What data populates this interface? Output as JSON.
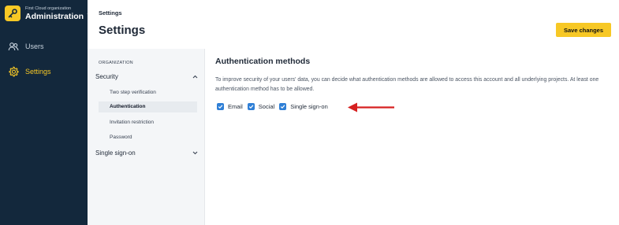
{
  "sidebar": {
    "org_subtitle": "First Cloud organization",
    "org_title": "Administration",
    "items": [
      {
        "label": "Users",
        "icon": "users-icon"
      },
      {
        "label": "Settings",
        "icon": "gear-icon"
      }
    ]
  },
  "header": {
    "breadcrumb": "Settings",
    "title": "Settings",
    "save_label": "Save changes"
  },
  "subnav": {
    "section_heading": "ORGANIZATION",
    "groups": [
      {
        "label": "Security",
        "items": [
          "Two step verification",
          "Authentication",
          "Invitation restriction",
          "Password"
        ]
      },
      {
        "label": "Single sign-on"
      }
    ]
  },
  "main": {
    "title": "Authentication methods",
    "description": "To improve security of your users' data, you can decide what authentication methods are allowed to access this account and all underlying projects. At least one authentication method has to be allowed.",
    "methods": [
      {
        "label": "Email",
        "checked": true
      },
      {
        "label": "Social",
        "checked": true
      },
      {
        "label": "Single sign-on",
        "checked": true
      }
    ]
  },
  "colors": {
    "sidebar_bg": "#13283c",
    "accent": "#f7c825",
    "checkbox": "#2f7fd6",
    "annotation_arrow": "#d62020"
  }
}
